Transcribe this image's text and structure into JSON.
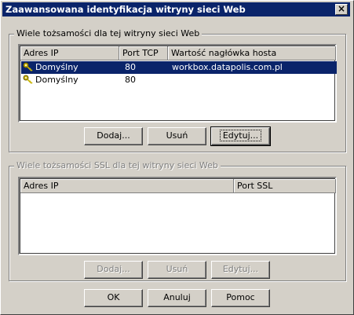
{
  "window": {
    "title": "Zaawansowana identyfikacja witryny sieci Web",
    "close_glyph": "×"
  },
  "group_identities": {
    "legend": "Wiele tożsamości dla tej witryny sieci Web",
    "columns": [
      "Adres IP",
      "Port TCP",
      "Wartość nagłówka hosta"
    ],
    "rows": [
      {
        "ip": "Domyślny",
        "port": "80",
        "host": "workbox.datapolis.com.pl",
        "selected": true
      },
      {
        "ip": "Domyślny",
        "port": "80",
        "host": "",
        "selected": false
      }
    ],
    "buttons": {
      "add": "Dodaj...",
      "remove": "Usuń",
      "edit": "Edytuj..."
    }
  },
  "group_ssl": {
    "legend": "Wiele tożsamości SSL dla tej witryny sieci Web",
    "columns": [
      "Adres IP",
      "Port SSL"
    ],
    "buttons": {
      "add": "Dodaj...",
      "remove": "Usuń",
      "edit": "Edytuj..."
    }
  },
  "footer": {
    "ok": "OK",
    "cancel": "Anuluj",
    "help": "Pomoc"
  }
}
